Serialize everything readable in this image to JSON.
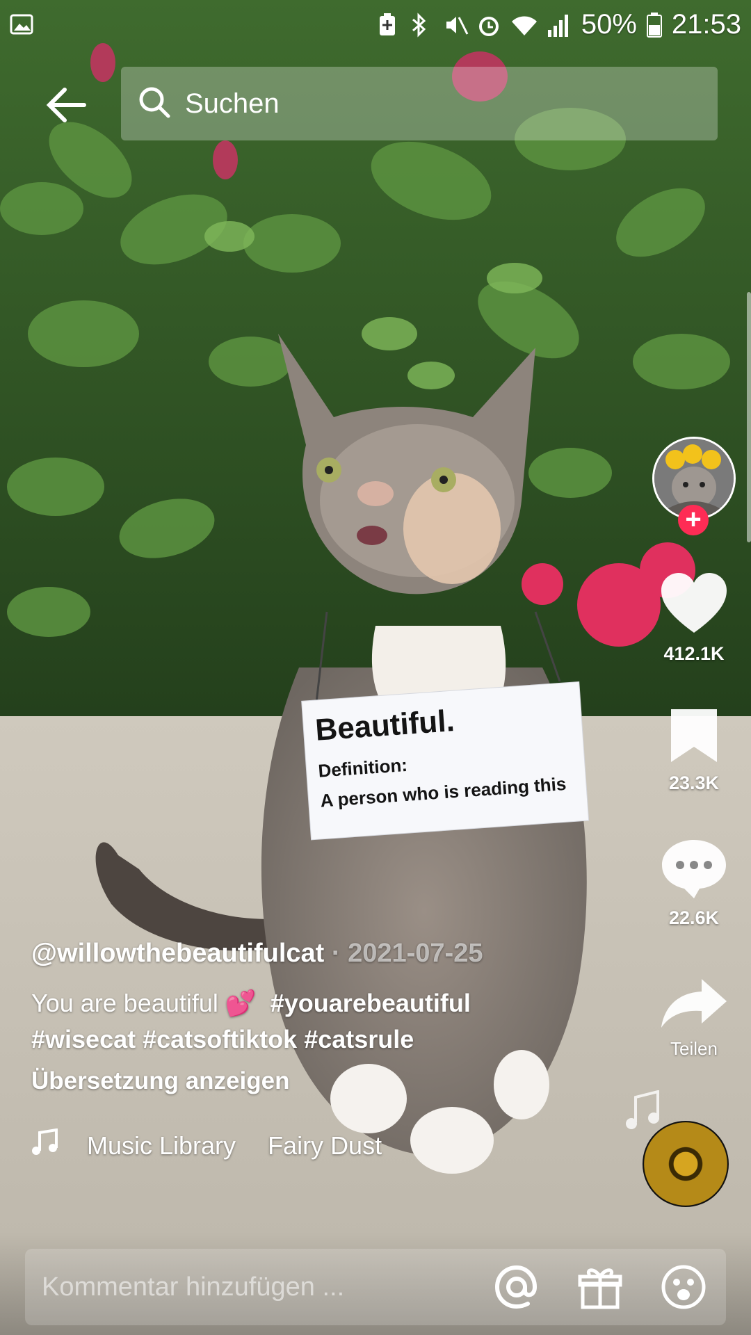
{
  "status_bar": {
    "battery_percent": "50%",
    "time": "21:53",
    "icons": [
      "image-icon",
      "battery-saver-icon",
      "bluetooth-icon",
      "mute-icon",
      "alarm-icon",
      "wifi-icon",
      "signal-icon",
      "battery-icon"
    ]
  },
  "header": {
    "back_icon": "arrow-left-icon",
    "search_placeholder": "Suchen",
    "search_icon": "search-icon"
  },
  "video_overlay_sign": {
    "title": "Beautiful.",
    "definition_label": "Definition:",
    "definition_text": "A person who is reading this"
  },
  "actions": {
    "likes": "412.1K",
    "bookmarks": "23.3K",
    "comments": "22.6K",
    "share_label": "Teilen"
  },
  "caption": {
    "username": "@willowthebeautifulcat",
    "separator": "·",
    "date": "2021-07-25",
    "text": "You are beautiful",
    "emoji": "💕",
    "hashtags_line1": "#youarebeautiful",
    "hashtags_line2": [
      "#wisecat",
      "#catsoftiktok",
      "#catsrule"
    ],
    "translate_label": "Übersetzung anzeigen"
  },
  "music": {
    "source": "Music Library",
    "title": "Fairy Dust"
  },
  "comment_bar": {
    "placeholder": "Kommentar hinzufügen ...",
    "icons": [
      "mention-icon",
      "gift-icon",
      "emoji-icon"
    ]
  },
  "colors": {
    "follow_plus": "#fe2c55",
    "text": "#ffffff"
  }
}
